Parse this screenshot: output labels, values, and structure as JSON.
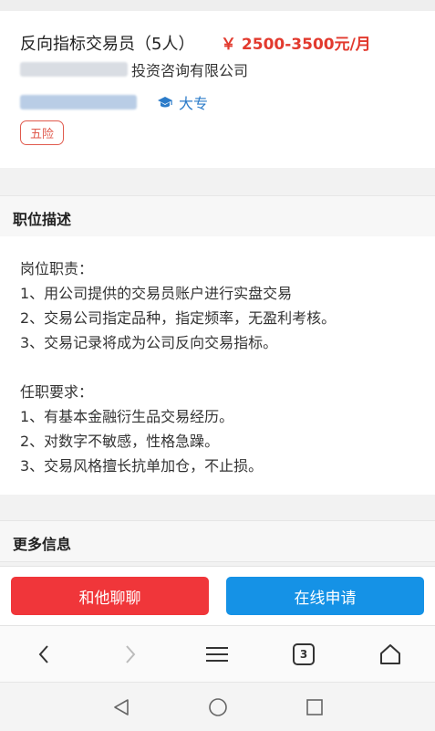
{
  "job": {
    "title": "反向指标交易员（5人）",
    "salary": "￥ 2500-3500元/月",
    "company_visible": "投资咨询有限公司",
    "education": "大专",
    "benefit_tag": "五险"
  },
  "sections": {
    "description_header": "职位描述",
    "more_info_header": "更多信息"
  },
  "description": {
    "lines": [
      "岗位职责：",
      "1、用公司提供的交易员账户进行实盘交易",
      "2、交易公司指定品种，指定频率，无盈利考核。",
      "3、交易记录将成为公司反向交易指标。",
      "",
      "任职要求：",
      "1、有基本金融衍生品交易经历。",
      "2、对数字不敏感，性格急躁。",
      "3、交易风格擅长抗单加仓，不止损。"
    ]
  },
  "actions": {
    "chat_label": "和他聊聊",
    "apply_label": "在线申请"
  },
  "browser_nav": {
    "tabs_count": "3"
  },
  "icons": {
    "education": "graduation-cap-icon",
    "back": "chevron-left-icon",
    "forward": "chevron-right-icon",
    "menu": "menu-icon",
    "tabs": "tabs-icon",
    "home": "home-icon",
    "sys_back": "triangle-back-icon",
    "sys_home": "circle-home-icon",
    "sys_recent": "square-recent-icon"
  },
  "colors": {
    "salary": "#e23a2e",
    "education": "#2b7bc9",
    "tag": "#e05a4d",
    "chat_button": "#f0363a",
    "apply_button": "#1592e6"
  }
}
